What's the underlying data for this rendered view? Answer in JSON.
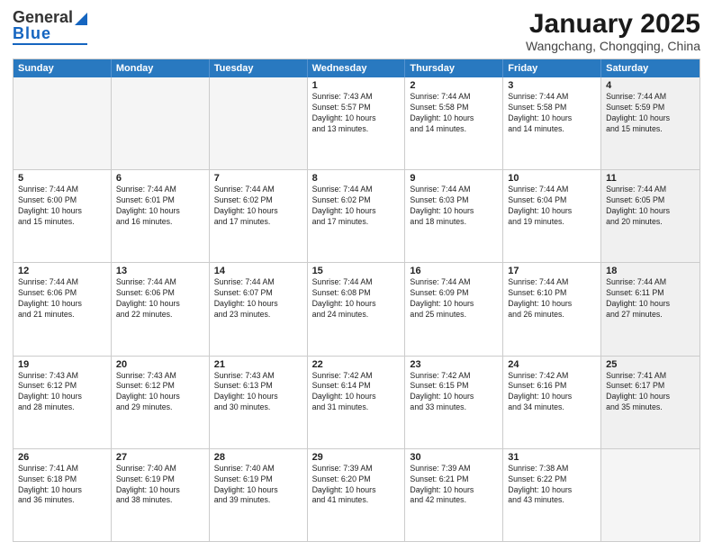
{
  "header": {
    "logo_general": "General",
    "logo_blue": "Blue",
    "month_title": "January 2025",
    "location": "Wangchang, Chongqing, China"
  },
  "days_of_week": [
    "Sunday",
    "Monday",
    "Tuesday",
    "Wednesday",
    "Thursday",
    "Friday",
    "Saturday"
  ],
  "weeks": [
    [
      {
        "day": "",
        "info": "",
        "empty": true
      },
      {
        "day": "",
        "info": "",
        "empty": true
      },
      {
        "day": "",
        "info": "",
        "empty": true
      },
      {
        "day": "1",
        "info": "Sunrise: 7:43 AM\nSunset: 5:57 PM\nDaylight: 10 hours\nand 13 minutes."
      },
      {
        "day": "2",
        "info": "Sunrise: 7:44 AM\nSunset: 5:58 PM\nDaylight: 10 hours\nand 14 minutes."
      },
      {
        "day": "3",
        "info": "Sunrise: 7:44 AM\nSunset: 5:58 PM\nDaylight: 10 hours\nand 14 minutes."
      },
      {
        "day": "4",
        "info": "Sunrise: 7:44 AM\nSunset: 5:59 PM\nDaylight: 10 hours\nand 15 minutes.",
        "shaded": true
      }
    ],
    [
      {
        "day": "5",
        "info": "Sunrise: 7:44 AM\nSunset: 6:00 PM\nDaylight: 10 hours\nand 15 minutes."
      },
      {
        "day": "6",
        "info": "Sunrise: 7:44 AM\nSunset: 6:01 PM\nDaylight: 10 hours\nand 16 minutes."
      },
      {
        "day": "7",
        "info": "Sunrise: 7:44 AM\nSunset: 6:02 PM\nDaylight: 10 hours\nand 17 minutes."
      },
      {
        "day": "8",
        "info": "Sunrise: 7:44 AM\nSunset: 6:02 PM\nDaylight: 10 hours\nand 17 minutes."
      },
      {
        "day": "9",
        "info": "Sunrise: 7:44 AM\nSunset: 6:03 PM\nDaylight: 10 hours\nand 18 minutes."
      },
      {
        "day": "10",
        "info": "Sunrise: 7:44 AM\nSunset: 6:04 PM\nDaylight: 10 hours\nand 19 minutes."
      },
      {
        "day": "11",
        "info": "Sunrise: 7:44 AM\nSunset: 6:05 PM\nDaylight: 10 hours\nand 20 minutes.",
        "shaded": true
      }
    ],
    [
      {
        "day": "12",
        "info": "Sunrise: 7:44 AM\nSunset: 6:06 PM\nDaylight: 10 hours\nand 21 minutes."
      },
      {
        "day": "13",
        "info": "Sunrise: 7:44 AM\nSunset: 6:06 PM\nDaylight: 10 hours\nand 22 minutes."
      },
      {
        "day": "14",
        "info": "Sunrise: 7:44 AM\nSunset: 6:07 PM\nDaylight: 10 hours\nand 23 minutes."
      },
      {
        "day": "15",
        "info": "Sunrise: 7:44 AM\nSunset: 6:08 PM\nDaylight: 10 hours\nand 24 minutes."
      },
      {
        "day": "16",
        "info": "Sunrise: 7:44 AM\nSunset: 6:09 PM\nDaylight: 10 hours\nand 25 minutes."
      },
      {
        "day": "17",
        "info": "Sunrise: 7:44 AM\nSunset: 6:10 PM\nDaylight: 10 hours\nand 26 minutes."
      },
      {
        "day": "18",
        "info": "Sunrise: 7:44 AM\nSunset: 6:11 PM\nDaylight: 10 hours\nand 27 minutes.",
        "shaded": true
      }
    ],
    [
      {
        "day": "19",
        "info": "Sunrise: 7:43 AM\nSunset: 6:12 PM\nDaylight: 10 hours\nand 28 minutes."
      },
      {
        "day": "20",
        "info": "Sunrise: 7:43 AM\nSunset: 6:12 PM\nDaylight: 10 hours\nand 29 minutes."
      },
      {
        "day": "21",
        "info": "Sunrise: 7:43 AM\nSunset: 6:13 PM\nDaylight: 10 hours\nand 30 minutes."
      },
      {
        "day": "22",
        "info": "Sunrise: 7:42 AM\nSunset: 6:14 PM\nDaylight: 10 hours\nand 31 minutes."
      },
      {
        "day": "23",
        "info": "Sunrise: 7:42 AM\nSunset: 6:15 PM\nDaylight: 10 hours\nand 33 minutes."
      },
      {
        "day": "24",
        "info": "Sunrise: 7:42 AM\nSunset: 6:16 PM\nDaylight: 10 hours\nand 34 minutes."
      },
      {
        "day": "25",
        "info": "Sunrise: 7:41 AM\nSunset: 6:17 PM\nDaylight: 10 hours\nand 35 minutes.",
        "shaded": true
      }
    ],
    [
      {
        "day": "26",
        "info": "Sunrise: 7:41 AM\nSunset: 6:18 PM\nDaylight: 10 hours\nand 36 minutes."
      },
      {
        "day": "27",
        "info": "Sunrise: 7:40 AM\nSunset: 6:19 PM\nDaylight: 10 hours\nand 38 minutes."
      },
      {
        "day": "28",
        "info": "Sunrise: 7:40 AM\nSunset: 6:19 PM\nDaylight: 10 hours\nand 39 minutes."
      },
      {
        "day": "29",
        "info": "Sunrise: 7:39 AM\nSunset: 6:20 PM\nDaylight: 10 hours\nand 41 minutes."
      },
      {
        "day": "30",
        "info": "Sunrise: 7:39 AM\nSunset: 6:21 PM\nDaylight: 10 hours\nand 42 minutes."
      },
      {
        "day": "31",
        "info": "Sunrise: 7:38 AM\nSunset: 6:22 PM\nDaylight: 10 hours\nand 43 minutes."
      },
      {
        "day": "",
        "info": "",
        "empty": true,
        "shaded": true
      }
    ]
  ]
}
